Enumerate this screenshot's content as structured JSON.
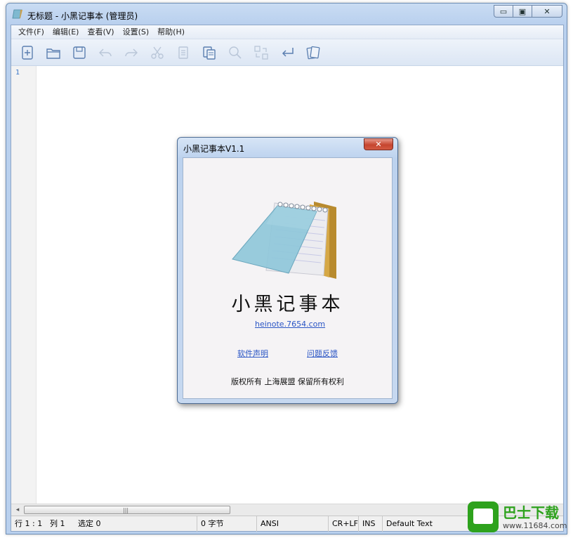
{
  "window": {
    "title": "无标题 - 小黑记事本 (管理员)",
    "caption_min": "▭",
    "caption_max": "▣",
    "caption_close": "✕"
  },
  "menu": {
    "items": [
      {
        "label": "文件(F)"
      },
      {
        "label": "编辑(E)"
      },
      {
        "label": "查看(V)"
      },
      {
        "label": "设置(S)"
      },
      {
        "label": "帮助(H)"
      }
    ]
  },
  "toolbar": {
    "buttons": [
      {
        "icon": "new-file-icon",
        "enabled": true
      },
      {
        "icon": "open-folder-icon",
        "enabled": true
      },
      {
        "icon": "save-icon",
        "enabled": true
      },
      {
        "icon": "undo-icon",
        "enabled": false
      },
      {
        "icon": "redo-icon",
        "enabled": false
      },
      {
        "icon": "cut-icon",
        "enabled": false
      },
      {
        "icon": "copy-icon",
        "enabled": false
      },
      {
        "icon": "paste-icon",
        "enabled": true
      },
      {
        "icon": "find-icon",
        "enabled": false
      },
      {
        "icon": "replace-icon",
        "enabled": false
      },
      {
        "icon": "wrap-icon",
        "enabled": true
      },
      {
        "icon": "theme-icon",
        "enabled": true
      }
    ]
  },
  "editor": {
    "line_number": "1"
  },
  "scrollbar": {
    "left_arrow": "◂",
    "grip": "|||"
  },
  "statusbar": {
    "position": "行 1 : 1",
    "column": "列 1",
    "selection": "选定 0",
    "bytes": "0 字节",
    "encoding": "ANSI",
    "line_ending": "CR+LF",
    "insert_mode": "INS",
    "text_type": "Default Text"
  },
  "about": {
    "title": "小黑记事本V1.1",
    "close": "✕",
    "app_name": "小黑记事本",
    "website": "heinote.7654.com",
    "license_link": "软件声明",
    "feedback_link": "问题反馈",
    "copyright": "版权所有 上海展盟 保留所有权利"
  },
  "watermark": {
    "brand": "巴士下载",
    "url": "www.11684.com"
  },
  "colors": {
    "accent": "#3a76c8",
    "link": "#2a55c5",
    "close_red": "#c6452f",
    "watermark_green": "#2ea21d"
  }
}
